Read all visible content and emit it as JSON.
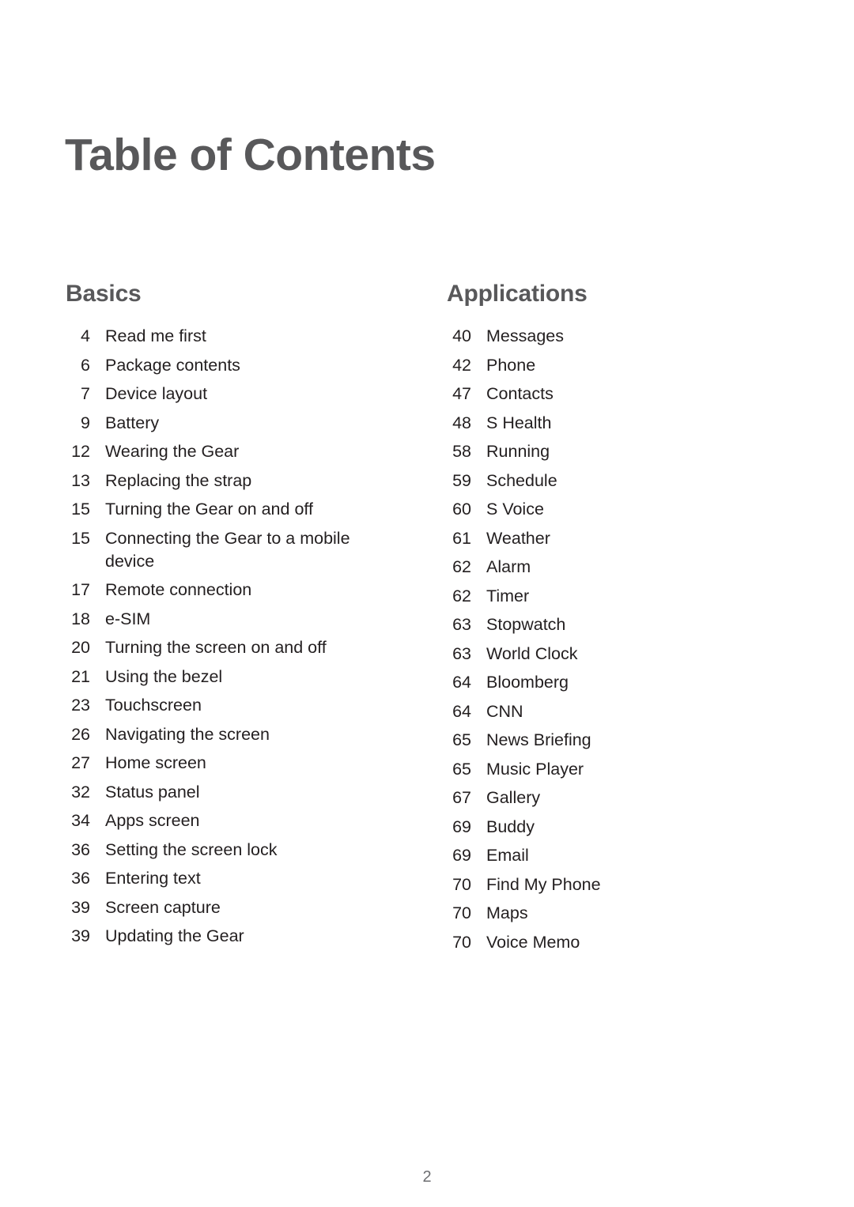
{
  "document": {
    "title": "Table of Contents",
    "page_number": "2",
    "colors": {
      "heading": "#58585a",
      "body_text": "#231f20",
      "page_number": "#6d6e71",
      "background": "#ffffff"
    }
  },
  "columns": [
    {
      "heading": "Basics",
      "entries": [
        {
          "page": "4",
          "title": "Read me first"
        },
        {
          "page": "6",
          "title": "Package contents"
        },
        {
          "page": "7",
          "title": "Device layout"
        },
        {
          "page": "9",
          "title": "Battery"
        },
        {
          "page": "12",
          "title": "Wearing the Gear"
        },
        {
          "page": "13",
          "title": "Replacing the strap"
        },
        {
          "page": "15",
          "title": "Turning the Gear on and off"
        },
        {
          "page": "15",
          "title": "Connecting the Gear to a mobile device"
        },
        {
          "page": "17",
          "title": "Remote connection"
        },
        {
          "page": "18",
          "title": "e-SIM"
        },
        {
          "page": "20",
          "title": "Turning the screen on and off"
        },
        {
          "page": "21",
          "title": "Using the bezel"
        },
        {
          "page": "23",
          "title": "Touchscreen"
        },
        {
          "page": "26",
          "title": "Navigating the screen"
        },
        {
          "page": "27",
          "title": "Home screen"
        },
        {
          "page": "32",
          "title": "Status panel"
        },
        {
          "page": "34",
          "title": "Apps screen"
        },
        {
          "page": "36",
          "title": "Setting the screen lock"
        },
        {
          "page": "36",
          "title": "Entering text"
        },
        {
          "page": "39",
          "title": "Screen capture"
        },
        {
          "page": "39",
          "title": "Updating the Gear"
        }
      ]
    },
    {
      "heading": "Applications",
      "entries": [
        {
          "page": "40",
          "title": "Messages"
        },
        {
          "page": "42",
          "title": "Phone"
        },
        {
          "page": "47",
          "title": "Contacts"
        },
        {
          "page": "48",
          "title": "S Health"
        },
        {
          "page": "58",
          "title": "Running"
        },
        {
          "page": "59",
          "title": "Schedule"
        },
        {
          "page": "60",
          "title": "S Voice"
        },
        {
          "page": "61",
          "title": "Weather"
        },
        {
          "page": "62",
          "title": "Alarm"
        },
        {
          "page": "62",
          "title": "Timer"
        },
        {
          "page": "63",
          "title": "Stopwatch"
        },
        {
          "page": "63",
          "title": "World Clock"
        },
        {
          "page": "64",
          "title": "Bloomberg"
        },
        {
          "page": "64",
          "title": "CNN"
        },
        {
          "page": "65",
          "title": "News Briefing"
        },
        {
          "page": "65",
          "title": "Music Player"
        },
        {
          "page": "67",
          "title": "Gallery"
        },
        {
          "page": "69",
          "title": "Buddy"
        },
        {
          "page": "69",
          "title": "Email"
        },
        {
          "page": "70",
          "title": "Find My Phone"
        },
        {
          "page": "70",
          "title": "Maps"
        },
        {
          "page": "70",
          "title": "Voice Memo"
        }
      ]
    }
  ]
}
